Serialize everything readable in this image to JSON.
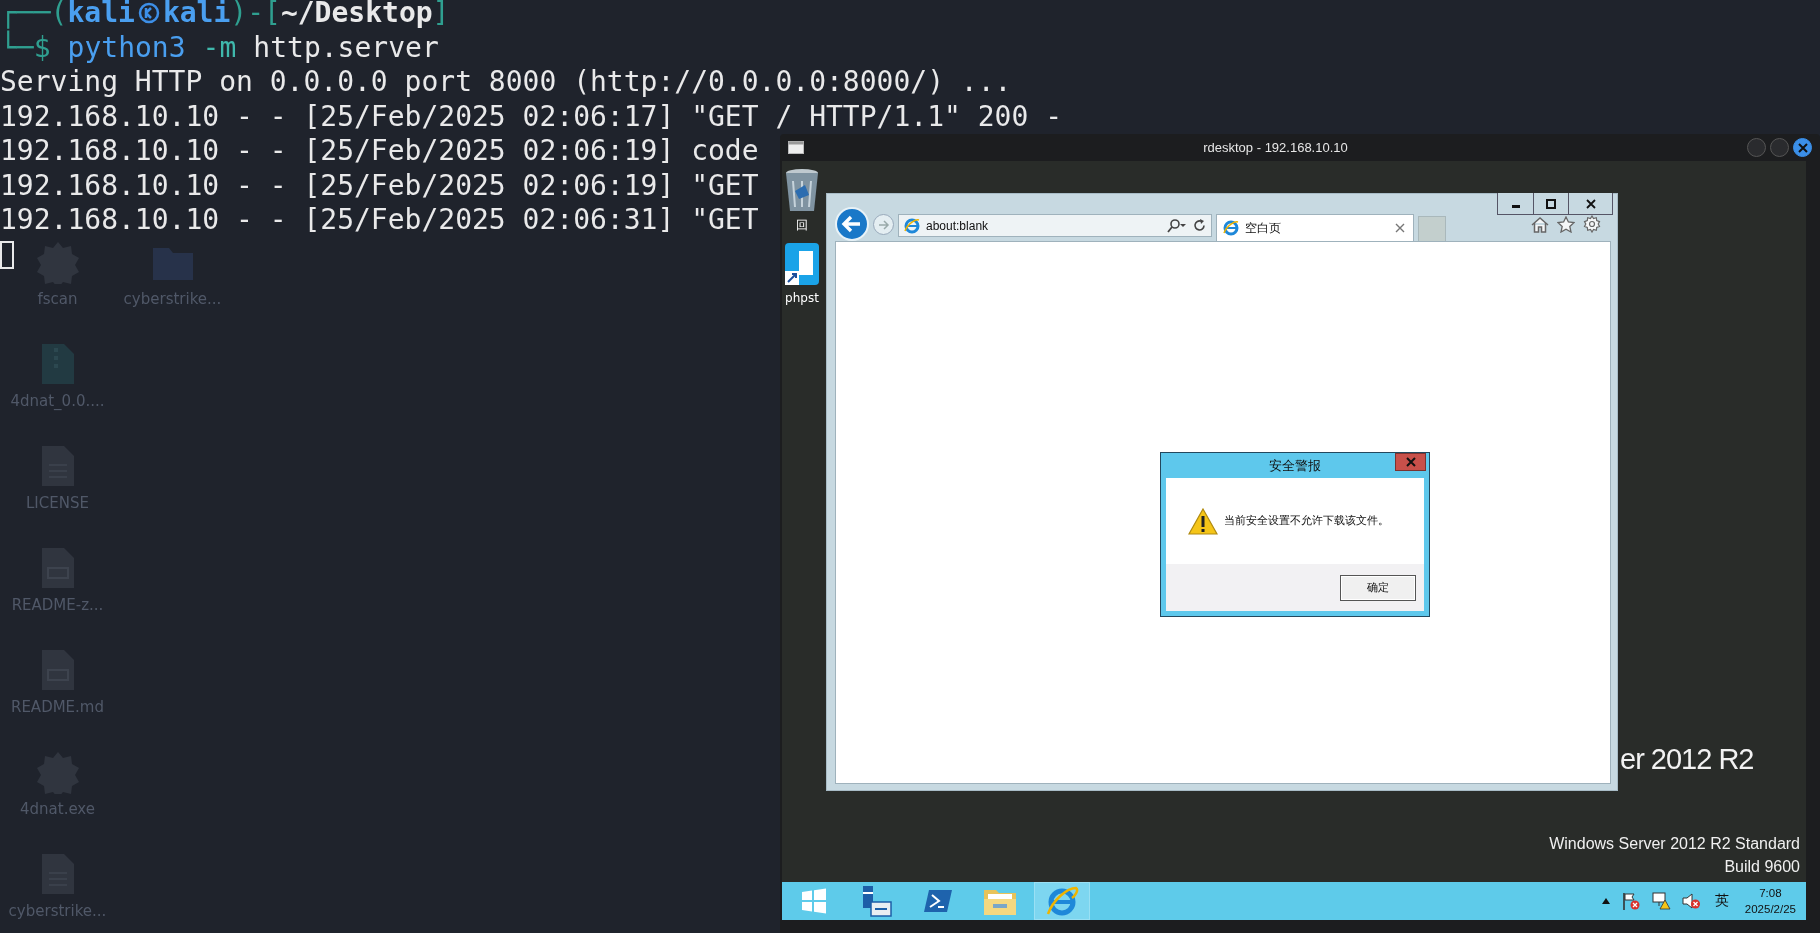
{
  "terminal": {
    "prompt": {
      "open": "┌──(",
      "user": "kali",
      "host": "kali",
      "middle": ")-[",
      "path": "~/Desktop",
      "close": "]"
    },
    "command": {
      "prefix": "└─$",
      "program": "python3",
      "flag": "-m",
      "module": "http.server"
    },
    "output": [
      "Serving HTTP on 0.0.0.0 port 8000 (http://0.0.0.0:8000/) ...",
      "192.168.10.10 - - [25/Feb/2025 02:06:17] \"GET / HTTP/1.1\" 200 -",
      "192.168.10.10 - - [25/Feb/2025 02:06:19] code",
      "192.168.10.10 - - [25/Feb/2025 02:06:19] \"GET",
      "192.168.10.10 - - [25/Feb/2025 02:06:31] \"GET"
    ]
  },
  "desktop_icons": [
    {
      "label": "fscan",
      "kind": "gear"
    },
    {
      "label": "cyberstrike...",
      "kind": "folder"
    },
    {
      "label": "4dnat_0.0....",
      "kind": "archive"
    },
    {
      "label": "LICENSE",
      "kind": "text"
    },
    {
      "label": "README-z...",
      "kind": "markdown"
    },
    {
      "label": "README.md",
      "kind": "markdown"
    },
    {
      "label": "4dnat.exe",
      "kind": "gear"
    },
    {
      "label": "cyberstrike...",
      "kind": "text"
    }
  ],
  "rdesktop": {
    "title": "rdesktop - 192.168.10.10",
    "remote_icons": [
      {
        "label": "回",
        "kind": "recycle-bin"
      },
      {
        "label": "phpst",
        "kind": "app"
      }
    ],
    "browser": {
      "address": "about:blank",
      "tab": "空白页"
    },
    "alert": {
      "title": "安全警报",
      "message": "当前安全设置不允许下载该文件。",
      "button": "确定"
    },
    "watermark": "er 2012 R2",
    "edition": "Windows Server 2012 R2 Standard",
    "build": "Build 9600",
    "taskbar": {
      "apps": [
        {
          "kind": "start",
          "selected": false
        },
        {
          "kind": "server-manager",
          "selected": false
        },
        {
          "kind": "powershell",
          "selected": false
        },
        {
          "kind": "explorer",
          "selected": false
        },
        {
          "kind": "ie",
          "selected": true
        }
      ],
      "ime": "英",
      "time": "7:08",
      "date": "2025/2/25"
    }
  }
}
